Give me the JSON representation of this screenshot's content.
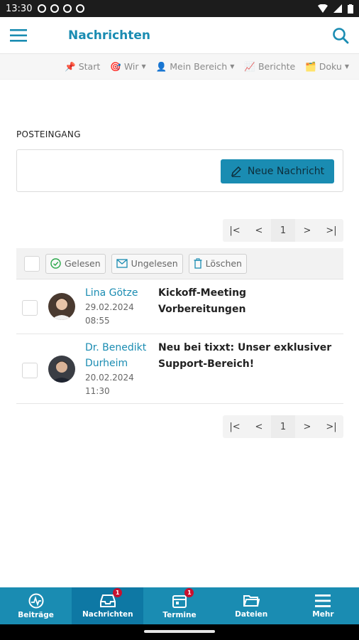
{
  "status": {
    "time": "13:30"
  },
  "appbar": {
    "title": "Nachrichten"
  },
  "nav2": {
    "items": [
      {
        "label": "Start",
        "icon": "pin-icon",
        "caret": false
      },
      {
        "label": "Wir",
        "icon": "target-icon",
        "caret": true
      },
      {
        "label": "Mein Bereich",
        "icon": "user-icon",
        "caret": true
      },
      {
        "label": "Berichte",
        "icon": "chart-icon",
        "caret": false
      },
      {
        "label": "Doku",
        "icon": "folder-icon",
        "caret": true
      }
    ]
  },
  "inbox": {
    "label": "POSTEINGANG",
    "new_message_label": "Neue Nachricht"
  },
  "pager": {
    "current_page": "1"
  },
  "toolbar": {
    "read_label": "Gelesen",
    "unread_label": "Ungelesen",
    "delete_label": "Löschen"
  },
  "messages": [
    {
      "sender": "Lina Götze",
      "date": "29.02.2024",
      "time": "08:55",
      "subject": "Kickoff-Meeting Vorbereitungen"
    },
    {
      "sender": "Dr. Benedikt Durheim",
      "date": "20.02.2024",
      "time": "11:30",
      "subject": "Neu bei tixxt: Unser exklusiver Support-Bereich!"
    }
  ],
  "tabs": [
    {
      "label": "Beiträge",
      "icon": "activity-icon",
      "badge": null,
      "active": false
    },
    {
      "label": "Nachrichten",
      "icon": "inbox-icon",
      "badge": "1",
      "active": true
    },
    {
      "label": "Termine",
      "icon": "calendar-icon",
      "badge": "1",
      "active": false
    },
    {
      "label": "Dateien",
      "icon": "folder-icon",
      "badge": null,
      "active": false
    },
    {
      "label": "Mehr",
      "icon": "menu-icon",
      "badge": null,
      "active": false
    }
  ],
  "colors": {
    "accent": "#1a8cb2",
    "badge": "#c8102e"
  }
}
